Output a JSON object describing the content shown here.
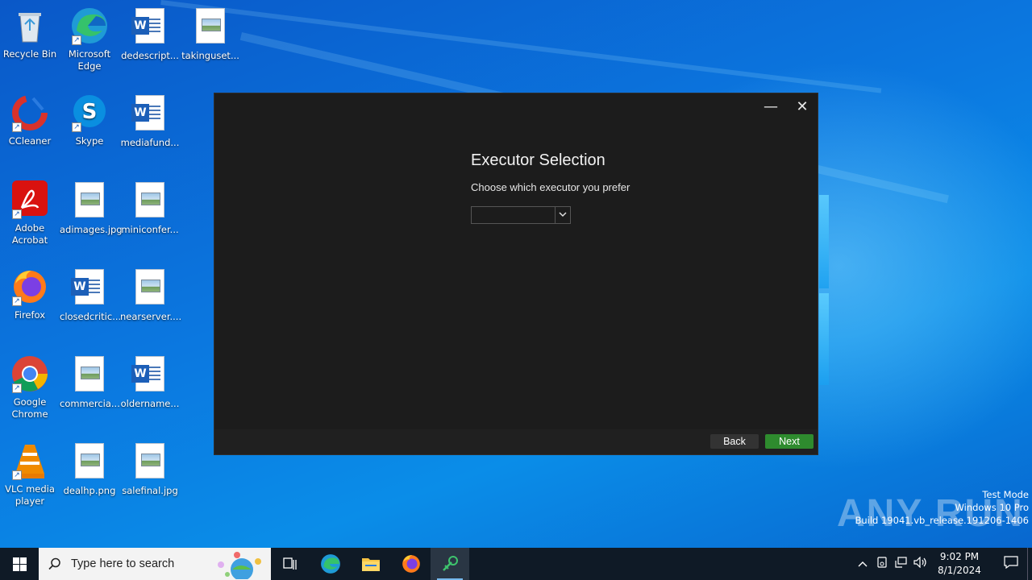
{
  "desktop": {
    "icons": [
      {
        "label": "Recycle Bin",
        "icon": "recycle-bin-icon"
      },
      {
        "label": "Microsoft Edge",
        "icon": "edge-icon"
      },
      {
        "label": "dedescript...",
        "icon": "word-doc-icon"
      },
      {
        "label": "takinguset...",
        "icon": "image-file-icon"
      },
      {
        "label": "CCleaner",
        "icon": "ccleaner-icon"
      },
      {
        "label": "Skype",
        "icon": "skype-icon"
      },
      {
        "label": "mediafund...",
        "icon": "word-doc-icon"
      },
      {
        "label": "Adobe Acrobat",
        "icon": "acrobat-icon"
      },
      {
        "label": "adimages.jpg",
        "icon": "image-file-icon"
      },
      {
        "label": "miniconfer...",
        "icon": "image-file-icon"
      },
      {
        "label": "Firefox",
        "icon": "firefox-icon"
      },
      {
        "label": "closedcritic...",
        "icon": "word-doc-icon"
      },
      {
        "label": "nearserver....",
        "icon": "image-file-icon"
      },
      {
        "label": "Google Chrome",
        "icon": "chrome-icon"
      },
      {
        "label": "commercia...",
        "icon": "image-file-icon"
      },
      {
        "label": "oldername...",
        "icon": "word-doc-icon"
      },
      {
        "label": "VLC media player",
        "icon": "vlc-icon"
      },
      {
        "label": "dealhp.png",
        "icon": "image-file-icon"
      },
      {
        "label": "salefinal.jpg",
        "icon": "image-file-icon"
      }
    ]
  },
  "dialog": {
    "title": "Executor Selection",
    "subtitle": "Choose which executor you prefer",
    "select_value": "",
    "back_label": "Back",
    "next_label": "Next",
    "minimize_glyph": "—",
    "close_glyph": "✕",
    "accent": "#2e8b2e"
  },
  "watermark": {
    "logo": "ANY RUN",
    "line1": "Test Mode",
    "line2": "Windows 10 Pro",
    "line3": "Build 19041.vb_release.191206-1406"
  },
  "taskbar": {
    "search_placeholder": "Type here to search",
    "time": "9:02 PM",
    "date": "8/1/2024",
    "pinned": [
      "task-view-icon",
      "edge-icon",
      "file-explorer-icon",
      "firefox-icon",
      "app-icon"
    ]
  }
}
